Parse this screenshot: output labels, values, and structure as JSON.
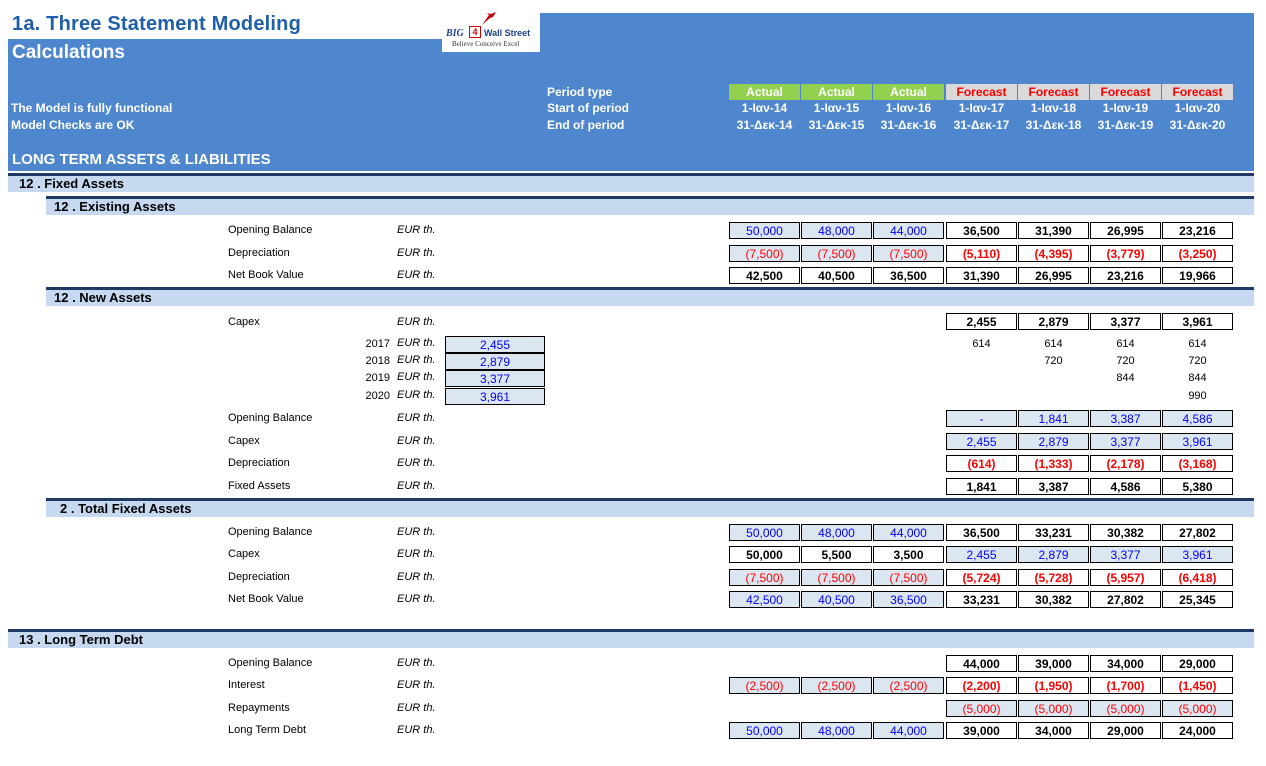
{
  "header": {
    "title": "1a. Three Statement Modeling",
    "subtitle": "Calculations",
    "status_lines": [
      "The Model is fully functional",
      "Model Checks are OK"
    ],
    "row_labels": [
      "Period type",
      "Start of period",
      "End of period"
    ],
    "section": "LONG TERM ASSETS & LIABILITIES",
    "logo": {
      "big": "BIG",
      "four": "4",
      "ws": "Wall Street",
      "tag": "Believe Conceive Excel"
    },
    "colors": {
      "band": "#4f87cf",
      "actual": "#92d050",
      "forecast": "#d9d9d9",
      "title": "#1f5ea8"
    }
  },
  "periods": {
    "types": [
      "Actual",
      "Actual",
      "Actual",
      "Forecast",
      "Forecast",
      "Forecast",
      "Forecast"
    ],
    "start": [
      "1-Ιαν-14",
      "1-Ιαν-15",
      "1-Ιαν-16",
      "1-Ιαν-17",
      "1-Ιαν-18",
      "1-Ιαν-19",
      "1-Ιαν-20"
    ],
    "end": [
      "31-Δεκ-14",
      "31-Δεκ-15",
      "31-Δεκ-16",
      "31-Δεκ-17",
      "31-Δεκ-18",
      "31-Δεκ-19",
      "31-Δεκ-20"
    ]
  },
  "sections": {
    "fixed_assets": "12 . Fixed Assets",
    "existing_assets": "12 . Existing Assets",
    "new_assets": "12 . New Assets",
    "total_fixed_assets": "2 . Total Fixed Assets",
    "long_term_debt": "13 . Long Term Debt"
  },
  "unit": "EUR th.",
  "existing_assets": [
    {
      "label": "Opening Balance",
      "values": [
        "50,000",
        "48,000",
        "44,000",
        "36,500",
        "31,390",
        "26,995",
        "23,216"
      ]
    },
    {
      "label": "Depreciation",
      "values": [
        "(7,500)",
        "(7,500)",
        "(7,500)",
        "(5,110)",
        "(4,395)",
        "(3,779)",
        "(3,250)"
      ]
    },
    {
      "label": "Net Book Value",
      "values": [
        "42,500",
        "40,500",
        "36,500",
        "31,390",
        "26,995",
        "23,216",
        "19,966"
      ]
    }
  ],
  "new_assets": {
    "capex": {
      "label": "Capex",
      "values": [
        "2,455",
        "2,879",
        "3,377",
        "3,961"
      ]
    },
    "capex_schedule": [
      {
        "year": "2017",
        "input": "2,455",
        "values": [
          "614",
          "614",
          "614",
          "614"
        ]
      },
      {
        "year": "2018",
        "input": "2,879",
        "values": [
          "",
          "720",
          "720",
          "720"
        ]
      },
      {
        "year": "2019",
        "input": "3,377",
        "values": [
          "",
          "",
          "844",
          "844"
        ]
      },
      {
        "year": "2020",
        "input": "3,961",
        "values": [
          "",
          "",
          "",
          "990"
        ]
      }
    ],
    "rows": [
      {
        "label": "Opening Balance",
        "values": [
          "-",
          "1,841",
          "3,387",
          "4,586"
        ]
      },
      {
        "label": "Capex",
        "values": [
          "2,455",
          "2,879",
          "3,377",
          "3,961"
        ]
      },
      {
        "label": "Depreciation",
        "values": [
          "(614)",
          "(1,333)",
          "(2,178)",
          "(3,168)"
        ]
      },
      {
        "label": "Fixed Assets",
        "values": [
          "1,841",
          "3,387",
          "4,586",
          "5,380"
        ]
      }
    ]
  },
  "total_fixed_assets": [
    {
      "label": "Opening Balance",
      "values": [
        "50,000",
        "48,000",
        "44,000",
        "36,500",
        "33,231",
        "30,382",
        "27,802"
      ]
    },
    {
      "label": "Capex",
      "values": [
        "50,000",
        "5,500",
        "3,500",
        "2,455",
        "2,879",
        "3,377",
        "3,961"
      ]
    },
    {
      "label": "Depreciation",
      "values": [
        "(7,500)",
        "(7,500)",
        "(7,500)",
        "(5,724)",
        "(5,728)",
        "(5,957)",
        "(6,418)"
      ]
    },
    {
      "label": "Net Book Value",
      "values": [
        "42,500",
        "40,500",
        "36,500",
        "33,231",
        "30,382",
        "27,802",
        "25,345"
      ]
    }
  ],
  "long_term_debt": [
    {
      "label": "Opening Balance",
      "values": [
        "",
        "",
        "",
        "44,000",
        "39,000",
        "34,000",
        "29,000"
      ]
    },
    {
      "label": "Interest",
      "values": [
        "(2,500)",
        "(2,500)",
        "(2,500)",
        "(2,200)",
        "(1,950)",
        "(1,700)",
        "(1,450)"
      ]
    },
    {
      "label": "Repayments",
      "values": [
        "",
        "",
        "",
        "(5,000)",
        "(5,000)",
        "(5,000)",
        "(5,000)"
      ]
    },
    {
      "label": "Long Term Debt",
      "values": [
        "50,000",
        "48,000",
        "44,000",
        "39,000",
        "34,000",
        "29,000",
        "24,000"
      ]
    }
  ]
}
